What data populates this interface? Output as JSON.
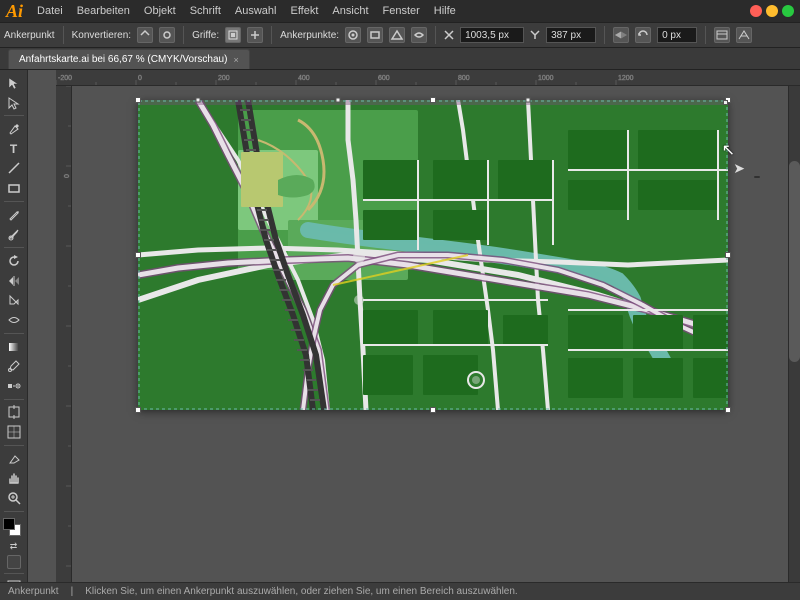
{
  "app": {
    "logo": "Ai",
    "title": "Adobe Illustrator"
  },
  "menu": {
    "items": [
      "Datei",
      "Bearbeiten",
      "Objekt",
      "Schrift",
      "Auswahl",
      "Effekt",
      "Ansicht",
      "Fenster",
      "Hilfe"
    ]
  },
  "options_bar": {
    "label_anchor": "Ankerpunkt",
    "label_convert": "Konvertieren:",
    "label_handles": "Griffe:",
    "label_anchorpoints": "Ankerpunkte:",
    "field_x_value": "1003,5 px",
    "field_y_value": "387 px",
    "field_extra": "0 px",
    "btn_icon1": "◁",
    "btn_icon2": "▷"
  },
  "tab": {
    "filename": "Anfahrtskarte.ai bei 66,67 % (CMYK/Vorschau)",
    "close_btn": "×"
  },
  "tools": [
    {
      "name": "select",
      "icon": "↖",
      "label": "Auswahl-Werkzeug"
    },
    {
      "name": "direct-select",
      "icon": "↖",
      "label": "Direktauswahl"
    },
    {
      "name": "pen",
      "icon": "✒",
      "label": "Zeichenstift"
    },
    {
      "name": "type",
      "icon": "T",
      "label": "Text"
    },
    {
      "name": "line",
      "icon": "╱",
      "label": "Linie"
    },
    {
      "name": "shape",
      "icon": "◻",
      "label": "Form"
    },
    {
      "name": "pencil",
      "icon": "✏",
      "label": "Bleistift"
    },
    {
      "name": "rotate",
      "icon": "↻",
      "label": "Drehen"
    },
    {
      "name": "scale",
      "icon": "⤡",
      "label": "Skalieren"
    },
    {
      "name": "warp",
      "icon": "⌂",
      "label": "Verzerren"
    },
    {
      "name": "gradient",
      "icon": "▦",
      "label": "Verlauf"
    },
    {
      "name": "eyedropper",
      "icon": "✦",
      "label": "Pipette"
    },
    {
      "name": "blend",
      "icon": "⁂",
      "label": "Angleichen"
    },
    {
      "name": "chart",
      "icon": "▦",
      "label": "Diagramm"
    },
    {
      "name": "slice",
      "icon": "⬡",
      "label": "Slice"
    },
    {
      "name": "eraser",
      "icon": "◻",
      "label": "Radiergummi"
    },
    {
      "name": "zoom",
      "icon": "⊕",
      "label": "Zoom"
    },
    {
      "name": "hand",
      "icon": "✋",
      "label": "Hand"
    }
  ],
  "color_blocks": {
    "foreground": "#000000",
    "background": "#ffffff",
    "stroke": "#000000",
    "fill": "#ffffff"
  },
  "canvas": {
    "zoom": "66,67",
    "color_mode": "CMYK",
    "preview_mode": "Vorschau"
  },
  "status": {
    "text": "Ankerpunkt"
  }
}
